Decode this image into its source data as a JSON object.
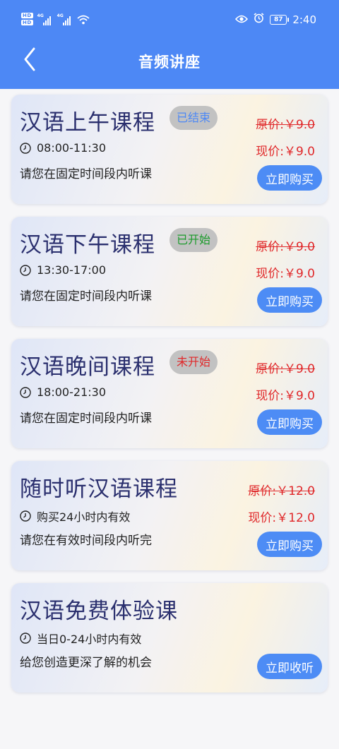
{
  "status_bar": {
    "hd1": "HD",
    "hd2": "HD",
    "signal1": "4G",
    "signal2": "4G",
    "battery": "87",
    "time": "2:40",
    "icons": [
      "eye-icon",
      "alarm-icon",
      "wifi-icon"
    ]
  },
  "header": {
    "title": "音频讲座",
    "back_icon": "chevron-left-icon"
  },
  "colors": {
    "header_bg": "#4d88f5",
    "button_bg": "#4d8cf5",
    "price_red": "#e0282a",
    "title_navy": "#2a2f6e",
    "badge_gray": "#c2c2c2",
    "badge_ended": "#4d88f5",
    "badge_started": "#1a9a2a",
    "badge_not_started": "#e0282a"
  },
  "courses": [
    {
      "title": "汉语上午课程",
      "badge": "已结束",
      "time": "08:00-11:30",
      "desc": "请您在固定时间段内听课",
      "orig_price": "原价:￥9.0",
      "cur_price": "现价:￥9.0",
      "button": "立即购买"
    },
    {
      "title": "汉语下午课程",
      "badge": "已开始",
      "time": "13:30-17:00",
      "desc": "请您在固定时间段内听课",
      "orig_price": "原价:￥9.0",
      "cur_price": "现价:￥9.0",
      "button": "立即购买"
    },
    {
      "title": "汉语晚间课程",
      "badge": "未开始",
      "time": "18:00-21:30",
      "desc": "请您在固定时间段内听课",
      "orig_price": "原价:￥9.0",
      "cur_price": "现价:￥9.0",
      "button": "立即购买"
    },
    {
      "title": "随时听汉语课程",
      "time": "购买24小时内有效",
      "desc": "请您在有效时间段内听完",
      "orig_price": "原价:￥12.0",
      "cur_price": "现价:￥12.0",
      "button": "立即购买"
    },
    {
      "title": "汉语免费体验课",
      "time": "当日0-24小时内有效",
      "desc": "给您创造更深了解的机会",
      "button": "立即收听"
    }
  ]
}
